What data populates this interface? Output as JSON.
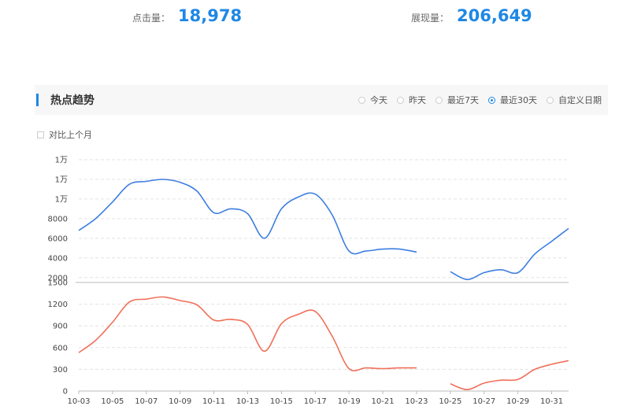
{
  "stats": {
    "clicks": {
      "label": "点击量：",
      "value": "18,978"
    },
    "views": {
      "label": "展现量：",
      "value": "206,649"
    }
  },
  "trend": {
    "title": "热点趋势",
    "options": [
      {
        "label": "今天",
        "selected": false
      },
      {
        "label": "昨天",
        "selected": false
      },
      {
        "label": "最近7天",
        "selected": false
      },
      {
        "label": "最近30天",
        "selected": true
      },
      {
        "label": "自定义日期",
        "selected": false
      }
    ],
    "compare_label": "对比上个月"
  },
  "colors": {
    "blue": "#3d7ee0",
    "red": "#f0705a",
    "accent": "#1e88e5"
  },
  "chart_data": {
    "type": "line",
    "x": [
      "10-03",
      "10-04",
      "10-05",
      "10-06",
      "10-07",
      "10-08",
      "10-09",
      "10-10",
      "10-11",
      "10-12",
      "10-13",
      "10-14",
      "10-15",
      "10-16",
      "10-17",
      "10-18",
      "10-19",
      "10-20",
      "10-21",
      "10-22",
      "10-23",
      "10-24",
      "10-25",
      "10-26",
      "10-27",
      "10-28",
      "10-29",
      "10-30",
      "10-31",
      "11-01"
    ],
    "xticks": [
      "10-03",
      "10-05",
      "10-07",
      "10-09",
      "10-11",
      "10-13",
      "10-15",
      "10-17",
      "10-19",
      "10-21",
      "10-23",
      "10-25",
      "10-27",
      "10-29",
      "10-31"
    ],
    "panels": [
      {
        "yticks": [
          "1万",
          "1万",
          "1万",
          "8000",
          "6000",
          "4000",
          "2000"
        ],
        "tick_values": [
          14000,
          12000,
          10000,
          8000,
          6000,
          4000,
          2000
        ],
        "ylim": [
          1500,
          14000
        ],
        "series": [
          {
            "color": "#3d7ee0",
            "values": [
              6800,
              8000,
              9700,
              11500,
              11800,
              12000,
              11700,
              10800,
              8600,
              9000,
              8500,
              6000,
              9000,
              10200,
              10500,
              8400,
              4700,
              4700,
              4900,
              4900,
              4600,
              null,
              2600,
              1800,
              2500,
              2800,
              2500,
              4400,
              5700,
              7000
            ]
          }
        ]
      },
      {
        "yticks": [
          "1500",
          "1200",
          "900",
          "600",
          "300",
          "0"
        ],
        "tick_values": [
          1500,
          1200,
          900,
          600,
          300,
          0
        ],
        "ylim": [
          0,
          1500
        ],
        "series": [
          {
            "color": "#f0705a",
            "values": [
              530,
              700,
              950,
              1230,
              1270,
              1300,
              1250,
              1190,
              980,
              990,
              920,
              550,
              930,
              1060,
              1100,
              760,
              310,
              320,
              310,
              320,
              320,
              null,
              100,
              20,
              110,
              150,
              160,
              300,
              370,
              420
            ]
          }
        ]
      }
    ],
    "grid": true
  }
}
